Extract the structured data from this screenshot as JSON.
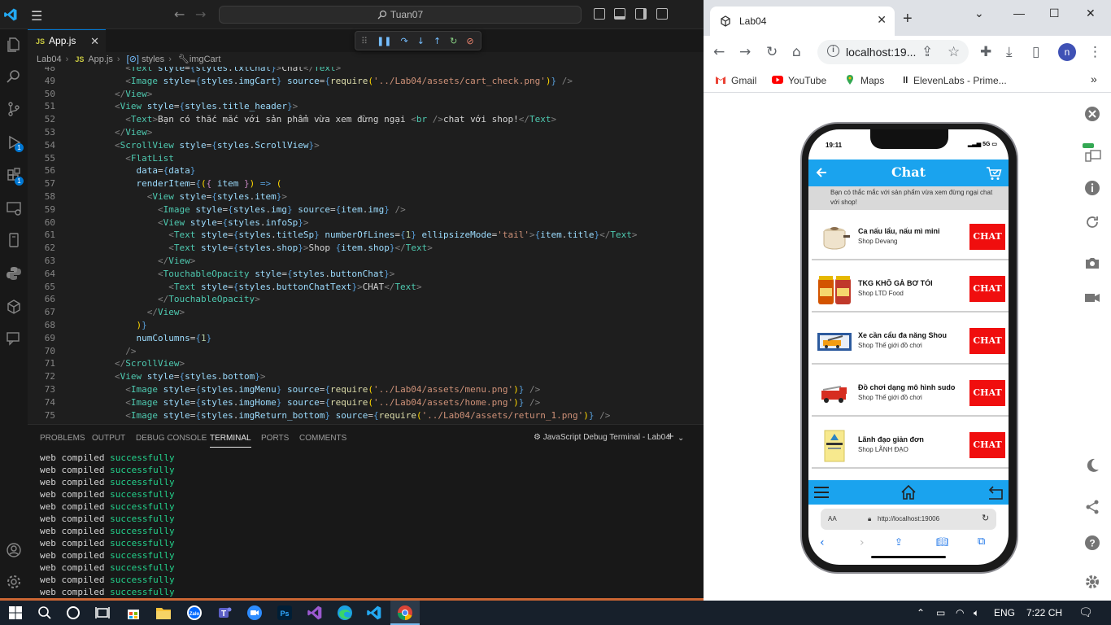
{
  "vscode": {
    "search_text": "Tuan07",
    "tab": {
      "label": "App.js",
      "badge": "JS"
    },
    "breadcrumb": [
      "Lab04",
      "App.js",
      "styles",
      "imgCart"
    ],
    "activity_badges": [
      "1",
      "1"
    ],
    "code_lines": [
      {
        "n": "48",
        "html": "<span class='tg'>&lt;</span><span class='tn'>Text</span> <span class='at'>style</span>=<span class='br'>{</span><span class='at'>styles</span>.<span class='at'>txtChat</span><span class='br'>}</span><span class='tg'>&gt;</span><span class='tx'>Chat</span><span class='tg'>&lt;/</span><span class='tn'>Text</span><span class='tg'>&gt;</span>",
        "indent": "          "
      },
      {
        "n": "49",
        "html": "<span class='tg'>&lt;</span><span class='tn'>Image</span> <span class='at'>style</span>=<span class='br'>{</span><span class='at'>styles</span>.<span class='at'>imgCart</span><span class='br'>}</span> <span class='at'>source</span>=<span class='br'>{</span><span class='fn'>require</span><span class='pu'>(</span><span class='st'>'../Lab04/assets/cart_check.png'</span><span class='pu'>)</span><span class='br'>}</span> <span class='tg'>/&gt;</span>",
        "indent": "          "
      },
      {
        "n": "50",
        "html": "<span class='tg'>&lt;/</span><span class='tn'>View</span><span class='tg'>&gt;</span>",
        "indent": "        "
      },
      {
        "n": "51",
        "html": "<span class='tg'>&lt;</span><span class='tn'>View</span> <span class='at'>style</span>=<span class='br'>{</span><span class='at'>styles</span>.<span class='at'>title_header</span><span class='br'>}</span><span class='tg'>&gt;</span>",
        "indent": "        "
      },
      {
        "n": "52",
        "html": "<span class='tg'>&lt;</span><span class='tn'>Text</span><span class='tg'>&gt;</span><span class='tx'>Bạn có thắc mắc với sản phẩm vừa xem đừng ngại </span><span class='tg'>&lt;</span><span class='tn'>br</span> <span class='tg'>/&gt;</span><span class='tx'>chat với shop!</span><span class='tg'>&lt;/</span><span class='tn'>Text</span><span class='tg'>&gt;</span>",
        "indent": "          "
      },
      {
        "n": "53",
        "html": "<span class='tg'>&lt;/</span><span class='tn'>View</span><span class='tg'>&gt;</span>",
        "indent": "        "
      },
      {
        "n": "54",
        "html": "<span class='tg'>&lt;</span><span class='tn'>ScrollView</span> <span class='at'>style</span>=<span class='br'>{</span><span class='at'>styles</span>.<span class='at'>ScrollView</span><span class='br'>}</span><span class='tg'>&gt;</span>",
        "indent": "        "
      },
      {
        "n": "55",
        "html": "<span class='tg'>&lt;</span><span class='tn'>FlatList</span>",
        "indent": "          "
      },
      {
        "n": "56",
        "html": "<span class='at'>data</span>=<span class='br'>{</span><span class='at'>data</span><span class='br'>}</span>",
        "indent": "            "
      },
      {
        "n": "57",
        "html": "<span class='at'>renderItem</span>=<span class='br'>{</span><span class='pu'>(</span><span class='kw'>{</span> <span class='at'>item</span> <span class='kw'>}</span><span class='pu'>)</span> <span class='br'>=&gt;</span> <span class='pu'>(</span>",
        "indent": "            "
      },
      {
        "n": "58",
        "html": "<span class='tg'>&lt;</span><span class='tn'>View</span> <span class='at'>style</span>=<span class='br'>{</span><span class='at'>styles</span>.<span class='at'>item</span><span class='br'>}</span><span class='tg'>&gt;</span>",
        "indent": "              "
      },
      {
        "n": "59",
        "html": "<span class='tg'>&lt;</span><span class='tn'>Image</span> <span class='at'>style</span>=<span class='br'>{</span><span class='at'>styles</span>.<span class='at'>img</span><span class='br'>}</span> <span class='at'>source</span>=<span class='br'>{</span><span class='at'>item</span>.<span class='at'>img</span><span class='br'>}</span> <span class='tg'>/&gt;</span>",
        "indent": "                "
      },
      {
        "n": "60",
        "html": "<span class='tg'>&lt;</span><span class='tn'>View</span> <span class='at'>style</span>=<span class='br'>{</span><span class='at'>styles</span>.<span class='at'>infoSp</span><span class='br'>}</span><span class='tg'>&gt;</span>",
        "indent": "                "
      },
      {
        "n": "61",
        "html": "<span class='tg'>&lt;</span><span class='tn'>Text</span> <span class='at'>style</span>=<span class='br'>{</span><span class='at'>styles</span>.<span class='at'>titleSp</span><span class='br'>}</span> <span class='at'>numberOfLines</span>=<span class='br'>{</span><span class='nu'>1</span><span class='br'>}</span> <span class='at'>ellipsizeMode</span>=<span class='st'>'tail'</span><span class='tg'>&gt;</span><span class='br'>{</span><span class='at'>item</span>.<span class='at'>title</span><span class='br'>}</span><span class='tg'>&lt;/</span><span class='tn'>Text</span><span class='tg'>&gt;</span>",
        "indent": "                  "
      },
      {
        "n": "62",
        "html": "<span class='tg'>&lt;</span><span class='tn'>Text</span> <span class='at'>style</span>=<span class='br'>{</span><span class='at'>styles</span>.<span class='at'>shop</span><span class='br'>}</span><span class='tg'>&gt;</span><span class='tx'>Shop </span><span class='br'>{</span><span class='at'>item</span>.<span class='at'>shop</span><span class='br'>}</span><span class='tg'>&lt;/</span><span class='tn'>Text</span><span class='tg'>&gt;</span>",
        "indent": "                  "
      },
      {
        "n": "63",
        "html": "<span class='tg'>&lt;/</span><span class='tn'>View</span><span class='tg'>&gt;</span>",
        "indent": "                "
      },
      {
        "n": "64",
        "html": "<span class='tg'>&lt;</span><span class='tn'>TouchableOpacity</span> <span class='at'>style</span>=<span class='br'>{</span><span class='at'>styles</span>.<span class='at'>buttonChat</span><span class='br'>}</span><span class='tg'>&gt;</span>",
        "indent": "                "
      },
      {
        "n": "65",
        "html": "<span class='tg'>&lt;</span><span class='tn'>Text</span> <span class='at'>style</span>=<span class='br'>{</span><span class='at'>styles</span>.<span class='at'>buttonChatText</span><span class='br'>}</span><span class='tg'>&gt;</span><span class='tx'>CHAT</span><span class='tg'>&lt;/</span><span class='tn'>Text</span><span class='tg'>&gt;</span>",
        "indent": "                  "
      },
      {
        "n": "66",
        "html": "<span class='tg'>&lt;/</span><span class='tn'>TouchableOpacity</span><span class='tg'>&gt;</span>",
        "indent": "                "
      },
      {
        "n": "67",
        "html": "<span class='tg'>&lt;/</span><span class='tn'>View</span><span class='tg'>&gt;</span>",
        "indent": "              "
      },
      {
        "n": "68",
        "html": "<span class='pu'>)</span><span class='br'>}</span>",
        "indent": "            "
      },
      {
        "n": "69",
        "html": "<span class='at'>numColumns</span>=<span class='br'>{</span><span class='nu'>1</span><span class='br'>}</span>",
        "indent": "            "
      },
      {
        "n": "70",
        "html": "<span class='tg'>/&gt;</span>",
        "indent": "          "
      },
      {
        "n": "71",
        "html": "<span class='tg'>&lt;/</span><span class='tn'>ScrollView</span><span class='tg'>&gt;</span>",
        "indent": "        "
      },
      {
        "n": "72",
        "html": "<span class='tg'>&lt;</span><span class='tn'>View</span> <span class='at'>style</span>=<span class='br'>{</span><span class='at'>styles</span>.<span class='at'>bottom</span><span class='br'>}</span><span class='tg'>&gt;</span>",
        "indent": "        "
      },
      {
        "n": "73",
        "html": "<span class='tg'>&lt;</span><span class='tn'>Image</span> <span class='at'>style</span>=<span class='br'>{</span><span class='at'>styles</span>.<span class='at'>imgMenu</span><span class='br'>}</span> <span class='at'>source</span>=<span class='br'>{</span><span class='fn'>require</span><span class='pu'>(</span><span class='st'>'../Lab04/assets/menu.png'</span><span class='pu'>)</span><span class='br'>}</span> <span class='tg'>/&gt;</span>",
        "indent": "          "
      },
      {
        "n": "74",
        "html": "<span class='tg'>&lt;</span><span class='tn'>Image</span> <span class='at'>style</span>=<span class='br'>{</span><span class='at'>styles</span>.<span class='at'>imgHome</span><span class='br'>}</span> <span class='at'>source</span>=<span class='br'>{</span><span class='fn'>require</span><span class='pu'>(</span><span class='st'>'../Lab04/assets/home.png'</span><span class='pu'>)</span><span class='br'>}</span> <span class='tg'>/&gt;</span>",
        "indent": "          "
      },
      {
        "n": "75",
        "html": "<span class='tg'>&lt;</span><span class='tn'>Image</span> <span class='at'>style</span>=<span class='br'>{</span><span class='at'>styles</span>.<span class='at'>imgReturn_bottom</span><span class='br'>}</span> <span class='at'>source</span>=<span class='br'>{</span><span class='fn'>require</span><span class='pu'>(</span><span class='st'>'../Lab04/assets/return_1.png'</span><span class='pu'>)</span><span class='br'>}</span> <span class='tg'>/&gt;</span>",
        "indent": "          "
      }
    ],
    "panel_tabs": [
      "PROBLEMS",
      "OUTPUT",
      "DEBUG CONSOLE",
      "TERMINAL",
      "PORTS",
      "COMMENTS"
    ],
    "terminal_name": "JavaScript Debug Terminal - Lab04",
    "terminal_lines": [
      [
        "web",
        "compiled",
        "successfully"
      ],
      [
        "web",
        "compiled",
        "successfully"
      ],
      [
        "web",
        "compiled",
        "successfully"
      ],
      [
        "web",
        "compiled",
        "successfully"
      ],
      [
        "web",
        "compiled",
        "successfully"
      ],
      [
        "web",
        "compiled",
        "successfully"
      ],
      [
        "web",
        "compiled",
        "successfully"
      ],
      [
        "web",
        "compiled",
        "successfully"
      ],
      [
        "web",
        "compiled",
        "successfully"
      ],
      [
        "web",
        "compiled",
        "successfully"
      ],
      [
        "web",
        "compiled",
        "successfully"
      ],
      [
        "web",
        "compiled",
        "successfully"
      ]
    ]
  },
  "chrome": {
    "tab_title": "Lab04",
    "url": "localhost:19...",
    "avatar": "n",
    "bookmarks": [
      "Gmail",
      "YouTube",
      "Maps",
      "ElevenLabs - Prime..."
    ]
  },
  "phone": {
    "time": "19:11",
    "signal": "5G",
    "header_title": "Chat",
    "subheader": "Bạn có thắc mắc với sản phẩm vừa xem đừng ngại chat với shop!",
    "chat_label": "CHAT",
    "items": [
      {
        "title": "Ca nấu lẩu, nấu mì mini",
        "shop": "Shop Devang"
      },
      {
        "title": "TKG KHÔ GÀ BƠ TỎI",
        "shop": "Shop LTD Food"
      },
      {
        "title": "Xe cần cẩu đa năng Shou",
        "shop": "Shop Thế giới đồ chơi"
      },
      {
        "title": "Đồ chơi dạng mô hình sudo",
        "shop": "Shop Thế giới đồ chơi"
      },
      {
        "title": "Lãnh đạo giản đơn",
        "shop": "Shop LÃNH ĐẠO"
      }
    ],
    "safari_aa": "AA",
    "safari_url": "http://localhost:19006"
  },
  "taskbar": {
    "lang": "ENG",
    "time": "7:22 CH"
  }
}
